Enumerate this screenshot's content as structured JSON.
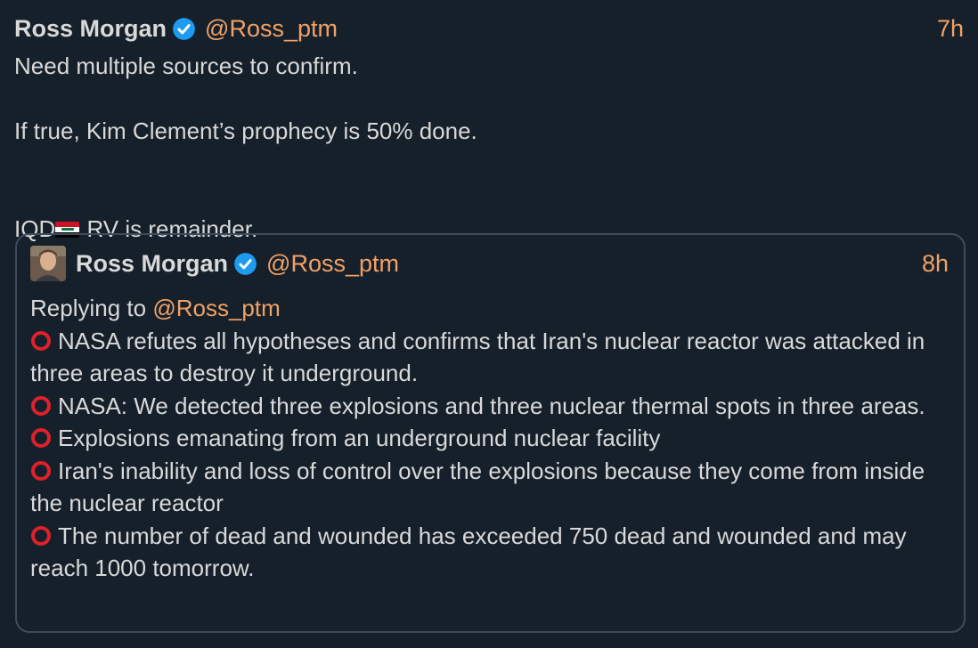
{
  "tweet": {
    "name": "Ross Morgan",
    "handle": "@Ross_ptm",
    "time": "7h",
    "line1": "Need multiple sources to confirm.",
    "line2": "If true, Kim Clement’s prophecy is 50% done.",
    "iqd": "IQD",
    "rv": " RV is remainder."
  },
  "quote": {
    "name": "Ross Morgan",
    "handle": "@Ross_ptm",
    "time": "8h",
    "replying_prefix": "Replying to ",
    "replying_handle": "@Ross_ptm",
    "items": [
      "NASA refutes all hypotheses and confirms that Iran's nuclear reactor was attacked in three areas to destroy it underground.",
      "NASA: We detected three explosions and three nuclear thermal spots in three areas.",
      "Explosions emanating from an underground nuclear facility",
      "Iran's inability and loss of control over the explosions because they come from inside the nuclear reactor",
      "The number of dead and wounded has exceeded 750 dead and wounded and may reach 1000 tomorrow."
    ]
  },
  "icons": {
    "verified": "verified-badge-icon",
    "bullet": "red-circle-icon",
    "flag": "iraq-flag-icon"
  },
  "colors": {
    "background": "#15202b",
    "text": "#d9d9d9",
    "accent": "#f2a166",
    "verified": "#1d9bf0",
    "border": "#3d4b5b",
    "bullet": "#e0202b"
  }
}
